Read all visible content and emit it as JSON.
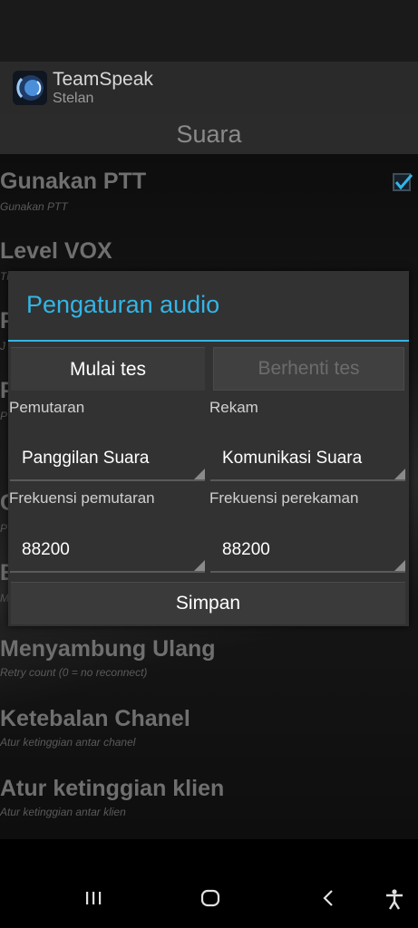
{
  "app": {
    "title": "TeamSpeak",
    "subtitle": "Stelan"
  },
  "section": {
    "title": "Suara"
  },
  "prefs": [
    {
      "title": "Gunakan PTT",
      "summary": "Gunakan PTT",
      "checked": true
    },
    {
      "title": "Level VOX",
      "summary": "Ti"
    },
    {
      "title": "P",
      "summary": "J"
    },
    {
      "title": "P",
      "summary": "P"
    },
    {
      "title": "C",
      "summary": "P"
    },
    {
      "title": "E",
      "summary": "M"
    },
    {
      "title": "Menyambung Ulang",
      "summary": "Retry count (0 = no reconnect)"
    },
    {
      "title": "Ketebalan Chanel",
      "summary": "Atur ketinggian antar chanel"
    },
    {
      "title": "Atur ketinggian klien",
      "summary": "Atur ketinggian antar klien"
    }
  ],
  "dialog": {
    "title": "Pengaturan audio",
    "start_test": "Mulai tes",
    "stop_test": "Berhenti tes",
    "playback_label": "Pemutaran",
    "playback_value": "Panggilan Suara",
    "record_label": "Rekam",
    "record_value": "Komunikasi Suara",
    "playback_freq_label": "Frekuensi pemutaran",
    "playback_freq_value": "88200",
    "record_freq_label": "Frekuensi perekaman",
    "record_freq_value": "88200",
    "save": "Simpan"
  },
  "icons": {
    "logo": "teamspeak-logo-icon",
    "checkbox": "checkbox-checked-icon",
    "nav_recent": "recent-apps-icon",
    "nav_home": "home-icon",
    "nav_back": "back-icon",
    "accessibility": "accessibility-icon"
  },
  "colors": {
    "accent": "#33b5e5",
    "dialog_bg": "#323232"
  }
}
